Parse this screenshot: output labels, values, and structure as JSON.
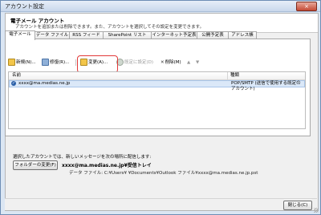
{
  "window": {
    "title": "アカウント設定"
  },
  "header": {
    "title": "電子メール アカウント",
    "description": "アカウントを追加または削除できます。また、アカウントを選択してその設定を変更できます。"
  },
  "tabs": [
    {
      "label": "電子メール"
    },
    {
      "label": "データ ファイル"
    },
    {
      "label": "RSS フィード"
    },
    {
      "label": "SharePoint リスト"
    },
    {
      "label": "インターネット予定表"
    },
    {
      "label": "公開予定表"
    },
    {
      "label": "アドレス帳"
    }
  ],
  "toolbar": {
    "new_label": "新規(N)...",
    "repair_label": "修復(R)...",
    "change_label": "変更(A)...",
    "default_label": "既定に設定(D)",
    "delete_label": "削除(M)",
    "up_arrow": "▲",
    "down_arrow": "▼"
  },
  "list": {
    "columns": {
      "name": "名前",
      "type": "種類"
    },
    "rows": [
      {
        "name": "xxxx@ma.medias.ne.jp",
        "type": "POP/SMTP (送信で使用する既定のアカウント)"
      }
    ]
  },
  "bottom": {
    "description": "選択したアカウントでは、新しいメッセージを次の場所に配信します:",
    "folder_button": "フォルダーの変更(F)",
    "folder_path": "xxxx@ma.medias.ne.jp¥受信トレイ",
    "data_file": "データ ファイル: C:¥Users¥         ¥Documents¥Outlook ファイル¥xxxx@ma.medias.ne.jp.pst"
  },
  "footer": {
    "close_label": "閉じる(C)"
  },
  "icons": {
    "close": "×",
    "check": "✓",
    "delete": "✕"
  },
  "colors": {
    "highlight": "#e23a3a",
    "accent": "#2a5fa8",
    "selected_row": "#dbe8f8"
  }
}
